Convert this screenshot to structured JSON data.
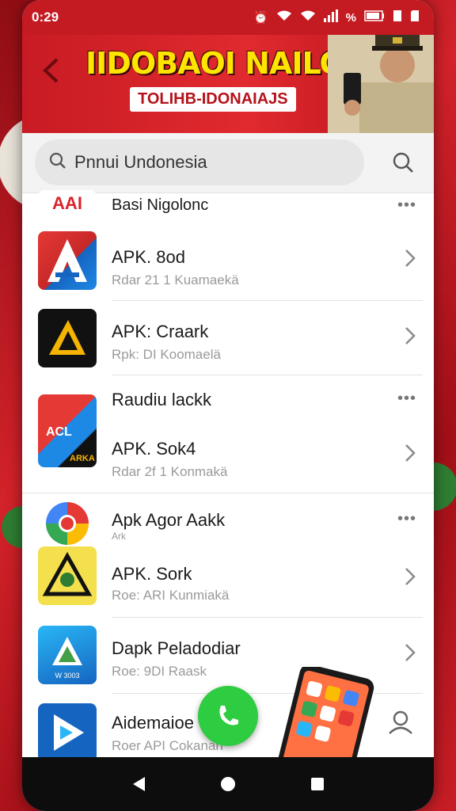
{
  "status_bar": {
    "time": "0:29",
    "battery_label": "%"
  },
  "banner": {
    "back_icon": "chevron-left-icon",
    "title": "IIDOBAOI NAILO",
    "subtitle": "TOLIHB-IDONAIAJS"
  },
  "search": {
    "value": "Pnnui Undonesia",
    "search_icon": "search-icon"
  },
  "list": {
    "items": [
      {
        "name": "Basi Nigolonc",
        "sub": "",
        "icon_text": "AAI",
        "action": "more"
      },
      {
        "name": "APK. 8od",
        "sub": "Rdar 21 1 Kuamaekä",
        "action": "chevron"
      },
      {
        "name": "APK: Craark",
        "sub": "Rpk: DI Koomaelä",
        "action": "chevron"
      },
      {
        "name": "Raudiu lackk",
        "sub": "",
        "action": "more"
      },
      {
        "name": "APK. Sok4",
        "sub": "Rdar 2f 1 Konmakä",
        "icon_text": "ACL",
        "icon_text2": "ARKA",
        "action": "chevron"
      },
      {
        "name": "Apk Agor Aakk",
        "sub": "Ark",
        "action": "more"
      },
      {
        "name": "APK. Sork",
        "sub": "Roe: ARI Kunmiakä",
        "action": "chevron"
      },
      {
        "name": "Dapk Peladodiar",
        "sub": "Roe: 9DI Raask",
        "icon_text": "W 3003",
        "action": "chevron"
      },
      {
        "name": "Aidemaioe",
        "sub": "Roer API Cokanan",
        "action": "none"
      }
    ]
  },
  "colors": {
    "status_red": "#c41a22",
    "banner_yellow": "#ffe400",
    "fab_green": "#2ecc40"
  },
  "navbar": {
    "back_icon": "triangle-back-icon",
    "home_icon": "circle-home-icon",
    "recents_icon": "square-recents-icon"
  }
}
